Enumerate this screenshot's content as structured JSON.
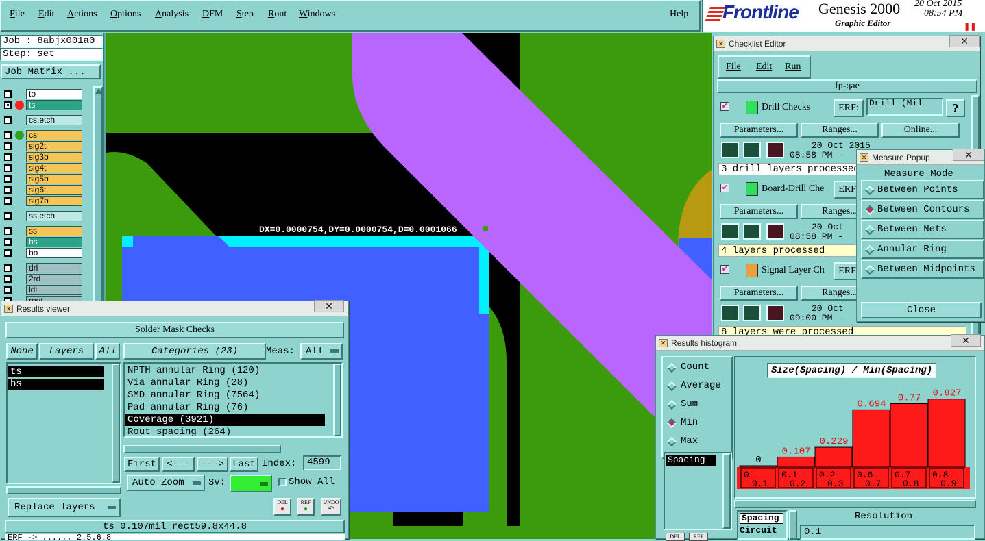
{
  "menubar": {
    "items": [
      "File",
      "Edit",
      "Actions",
      "Options",
      "Analysis",
      "DFM",
      "Step",
      "Rout",
      "Windows"
    ],
    "help": "Help"
  },
  "brand": {
    "logo": "Frontline",
    "product": "Genesis 2000",
    "subtitle": "Graphic Editor",
    "date": "20 Oct 2015",
    "time": "08:54 PM"
  },
  "job": {
    "job_label": "Job : 8abjx001a0",
    "step_label": "Step: set",
    "matrix_button": "Job Matrix ..."
  },
  "layers": [
    {
      "name": "to",
      "color": "white",
      "marker": ""
    },
    {
      "name": "ts",
      "color": "teal",
      "marker": "red",
      "active": true
    },
    {
      "name": "cs.etch",
      "color": "cyan",
      "marker": ""
    },
    {
      "name": "cs",
      "color": "yellow",
      "marker": "green"
    },
    {
      "name": "sig2t",
      "color": "yellow",
      "marker": ""
    },
    {
      "name": "sig3b",
      "color": "yellow",
      "marker": ""
    },
    {
      "name": "sig4t",
      "color": "yellow",
      "marker": ""
    },
    {
      "name": "sig5b",
      "color": "yellow",
      "marker": ""
    },
    {
      "name": "sig6t",
      "color": "yellow",
      "marker": ""
    },
    {
      "name": "sig7b",
      "color": "yellow",
      "marker": ""
    },
    {
      "name": "ss.etch",
      "color": "cyan",
      "marker": ""
    },
    {
      "name": "ss",
      "color": "yellow",
      "marker": ""
    },
    {
      "name": "bs",
      "color": "teal",
      "marker": ""
    },
    {
      "name": "bo",
      "color": "white",
      "marker": ""
    },
    {
      "name": "drl",
      "color": "gray",
      "marker": ""
    },
    {
      "name": "2rd",
      "color": "gray",
      "marker": ""
    },
    {
      "name": "ldi",
      "color": "gray",
      "marker": ""
    },
    {
      "name": "rout",
      "color": "gray",
      "marker": ""
    }
  ],
  "canvas": {
    "measure_text": "DX=0.0000754,DY=0.0000754,D=0.0001066"
  },
  "results_viewer": {
    "title": "Results viewer",
    "header": "Solder Mask Checks",
    "none_btn": "None",
    "layers_btn": "Layers",
    "all_btn": "All",
    "categories_btn": "Categories (23)",
    "meas_label": "Meas:",
    "meas_value": "All",
    "layers_list": [
      "ts",
      "bs"
    ],
    "categories": [
      "NPTH annular Ring (120)",
      "Via annular Ring (28)",
      "SMD annular Ring (7564)",
      "Pad annular Ring (76)",
      "Coverage (3921)",
      "Rout spacing (264)"
    ],
    "selected_category": 4,
    "first_btn": "First",
    "prev_btn": "<---",
    "next_btn": "--->",
    "last_btn": "Last",
    "index_label": "Index:",
    "index_value": "4599",
    "autozoom_btn": "Auto Zoom",
    "sv_label": "Sv:",
    "show_all": "Show All",
    "replace_btn": "Replace layers",
    "del_icon": "DEL",
    "ref_icon": "REF",
    "undo_icon": "UNDO",
    "status": "ts 0.107mil   rect59.8x44.8",
    "bottom_cut": "ERF -> ......  2.5.6.8"
  },
  "checklist": {
    "title": "Checklist Editor",
    "menu": [
      "File",
      "Edit",
      "Run"
    ],
    "name": "fp-qae",
    "erf_label": "ERF:",
    "erf_value": "Drill (Mil",
    "help_btn": "?",
    "params_btn": "Parameters...",
    "ranges_btn": "Ranges...",
    "online_btn": "Online...",
    "checks": [
      {
        "name": "Drill Checks",
        "date": "20 Oct 2015",
        "time": "08:58 PM -",
        "status": "3 drill layers processed"
      },
      {
        "name": "Board-Drill Che",
        "date": "20 Oct",
        "time": "08:58 PM -",
        "status": "4 layers processed"
      },
      {
        "name": "Signal Layer Ch",
        "date": "20 Oct",
        "time": "09:00 PM -",
        "status": "8 layers were processed"
      }
    ]
  },
  "measure_popup": {
    "title": "Measure Popup",
    "mode_label": "Measure Mode",
    "modes": [
      "Between Points",
      "Between Contours",
      "Between Nets",
      "Annular Ring",
      "Between Midpoints"
    ],
    "selected_mode": 1,
    "close_btn": "Close"
  },
  "histogram": {
    "title": "Results histogram",
    "radio": [
      "Count",
      "Average",
      "Sum",
      "Min",
      "Max"
    ],
    "selected_radio": 3,
    "list_item": "Spacing",
    "list_item2": "Circuit",
    "resolution_label": "Resolution",
    "resolution_value": "0.1",
    "del_icon": "DEL",
    "ref_icon": "REF"
  },
  "chart_data": {
    "type": "bar",
    "title": "Size(Spacing) / Min(Spacing)",
    "categories": [
      "0-0.1",
      "0.1-0.2",
      "0.2-0.3",
      "0.6-0.7",
      "0.7-0.8",
      "0.8-0.9"
    ],
    "values": [
      0,
      0.107,
      0.229,
      0.694,
      0.77,
      0.827
    ],
    "value_labels": [
      "0",
      "0.107",
      "0.229",
      "0.694",
      "0.77",
      "0.827"
    ],
    "ylim": [
      0,
      0.85
    ],
    "grid": false,
    "legend": "none",
    "bar_color": "#ff1a1a",
    "label_color": "#e01010"
  }
}
